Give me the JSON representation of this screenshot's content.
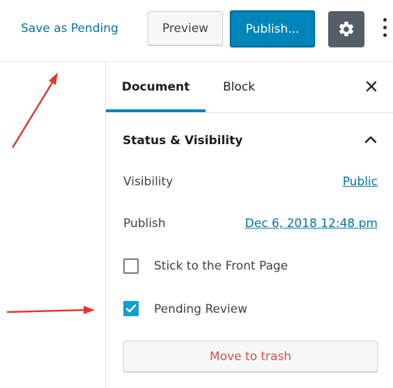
{
  "header": {
    "save_pending_label": "Save as Pending",
    "preview_label": "Preview",
    "publish_label": "Publish...",
    "settings_icon": "gear-icon",
    "more_icon": "more-vertical-icon"
  },
  "tabs": {
    "document_label": "Document",
    "block_label": "Block",
    "close_icon": "close-icon"
  },
  "panel": {
    "title": "Status & Visibility",
    "toggle_icon": "chevron-up-icon",
    "visibility": {
      "label": "Visibility",
      "value": "Public"
    },
    "publish": {
      "label": "Publish",
      "value": "Dec 6, 2018 12:48 pm"
    },
    "sticky": {
      "label": "Stick to the Front Page",
      "checked": false
    },
    "pending": {
      "label": "Pending Review",
      "checked": true
    },
    "trash_label": "Move to trash"
  },
  "colors": {
    "accent": "#0085ba",
    "link": "#0073aa",
    "destructive": "#d94f4f",
    "annotation": "#e3342f"
  }
}
